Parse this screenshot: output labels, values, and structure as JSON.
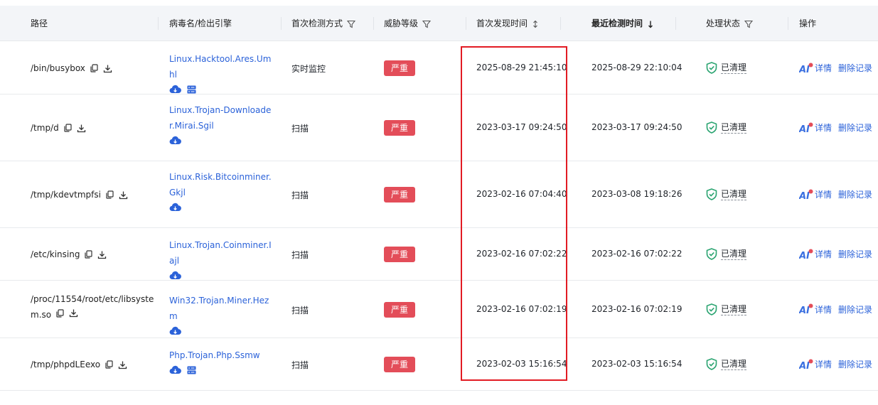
{
  "columns": {
    "path": "路径",
    "virus": "病毒名/检出引擎",
    "method": "首次检测方式",
    "level": "威胁等级",
    "first_time": "首次发现时间",
    "last_time": "最近检测时间",
    "status": "处理状态",
    "ops": "操作"
  },
  "rows": [
    {
      "path": "/bin/busybox",
      "virus": "Linux.Hacktool.Ares.Umhl",
      "engines": [
        "cloud",
        "server"
      ],
      "method": "实时监控",
      "level": "严重",
      "first_time": "2025-08-29 21:45:10",
      "last_time": "2025-08-29 22:10:04",
      "status": "已清理",
      "detail": "详情",
      "delete": "删除记录"
    },
    {
      "path": "/tmp/d",
      "virus": "Linux.Trojan-Downloader.Mirai.Sgil",
      "engines": [
        "cloud"
      ],
      "method": "扫描",
      "level": "严重",
      "first_time": "2023-03-17 09:24:50",
      "last_time": "2023-03-17 09:24:50",
      "status": "已清理",
      "detail": "详情",
      "delete": "删除记录"
    },
    {
      "path": "/tmp/kdevtmpfsi",
      "virus": "Linux.Risk.Bitcoinminer.Gkjl",
      "engines": [
        "cloud"
      ],
      "method": "扫描",
      "level": "严重",
      "first_time": "2023-02-16 07:04:40",
      "last_time": "2023-03-08 19:18:26",
      "status": "已清理",
      "detail": "详情",
      "delete": "删除记录"
    },
    {
      "path": "/etc/kinsing",
      "virus": "Linux.Trojan.Coinminer.Iajl",
      "engines": [
        "cloud"
      ],
      "method": "扫描",
      "level": "严重",
      "first_time": "2023-02-16 07:02:22",
      "last_time": "2023-02-16 07:02:22",
      "status": "已清理",
      "detail": "详情",
      "delete": "删除记录"
    },
    {
      "path": "/proc/11554/root/etc/libsystem.so",
      "virus": "Win32.Trojan.Miner.Hezm",
      "engines": [
        "cloud"
      ],
      "method": "扫描",
      "level": "严重",
      "first_time": "2023-02-16 07:02:19",
      "last_time": "2023-02-16 07:02:19",
      "status": "已清理",
      "detail": "详情",
      "delete": "删除记录"
    },
    {
      "path": "/tmp/phpdLEexo",
      "virus": "Php.Trojan.Php.Ssmw",
      "engines": [
        "cloud",
        "server"
      ],
      "method": "扫描",
      "level": "严重",
      "first_time": "2023-02-03 15:16:54",
      "last_time": "2023-02-03 15:16:54",
      "status": "已清理",
      "detail": "详情",
      "delete": "删除记录"
    }
  ],
  "icons": {
    "copy": "copy-icon",
    "download": "download-icon",
    "cloud": "cloud-engine-icon",
    "server": "server-engine-icon",
    "shield": "shield-check-icon",
    "ai": "ai-icon"
  },
  "colors": {
    "link": "#2b62d9",
    "danger": "#e34d59",
    "success": "#2ba471",
    "highlight": "#e21b23"
  }
}
